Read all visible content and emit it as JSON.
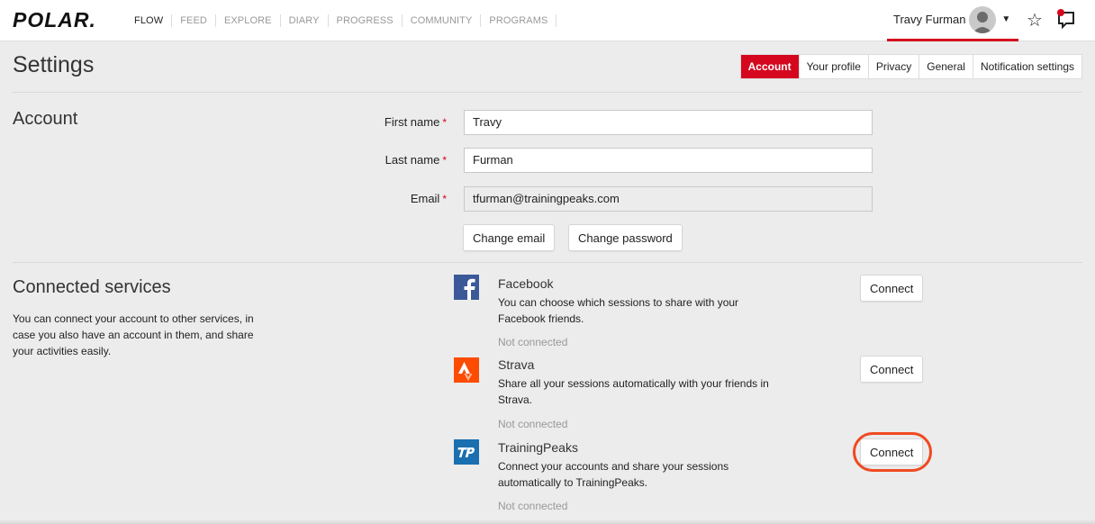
{
  "brand": {
    "logo_text": "POLAR."
  },
  "nav": {
    "items": [
      {
        "label": "FLOW",
        "active": true
      },
      {
        "label": "FEED",
        "active": false
      },
      {
        "label": "EXPLORE",
        "active": false
      },
      {
        "label": "DIARY",
        "active": false
      },
      {
        "label": "PROGRESS",
        "active": false
      },
      {
        "label": "COMMUNITY",
        "active": false
      },
      {
        "label": "PROGRAMS",
        "active": false
      }
    ]
  },
  "user": {
    "name": "Travy Furman"
  },
  "page": {
    "title": "Settings"
  },
  "tabs": [
    {
      "label": "Account",
      "active": true
    },
    {
      "label": "Your profile",
      "active": false
    },
    {
      "label": "Privacy",
      "active": false
    },
    {
      "label": "General",
      "active": false
    },
    {
      "label": "Notification settings",
      "active": false
    }
  ],
  "account": {
    "title": "Account",
    "first_name_label": "First name",
    "first_name_value": "Travy",
    "last_name_label": "Last name",
    "last_name_value": "Furman",
    "email_label": "Email",
    "email_value": "tfurman@trainingpeaks.com",
    "required_mark": "*",
    "change_email_label": "Change email",
    "change_password_label": "Change password"
  },
  "connected": {
    "title": "Connected services",
    "description": "You can connect your account to other services, in case you also have an account in them, and share your activities easily.",
    "services": [
      {
        "name": "Facebook",
        "description": "You can choose which sessions to share with your Facebook friends.",
        "status": "Not connected",
        "button": "Connect"
      },
      {
        "name": "Strava",
        "description": "Share all your sessions automatically with your friends in Strava.",
        "status": "Not connected",
        "button": "Connect"
      },
      {
        "name": "TrainingPeaks",
        "description": "Connect your accounts and share your sessions automatically to TrainingPeaks.",
        "status": "Not connected",
        "button": "Connect"
      }
    ]
  },
  "colors": {
    "brand_red": "#d4071f",
    "highlight_orange": "#ef4a21",
    "facebook_blue": "#3b5998",
    "strava_orange": "#fc4c02",
    "trainingpeaks_blue": "#1a6fb0"
  }
}
